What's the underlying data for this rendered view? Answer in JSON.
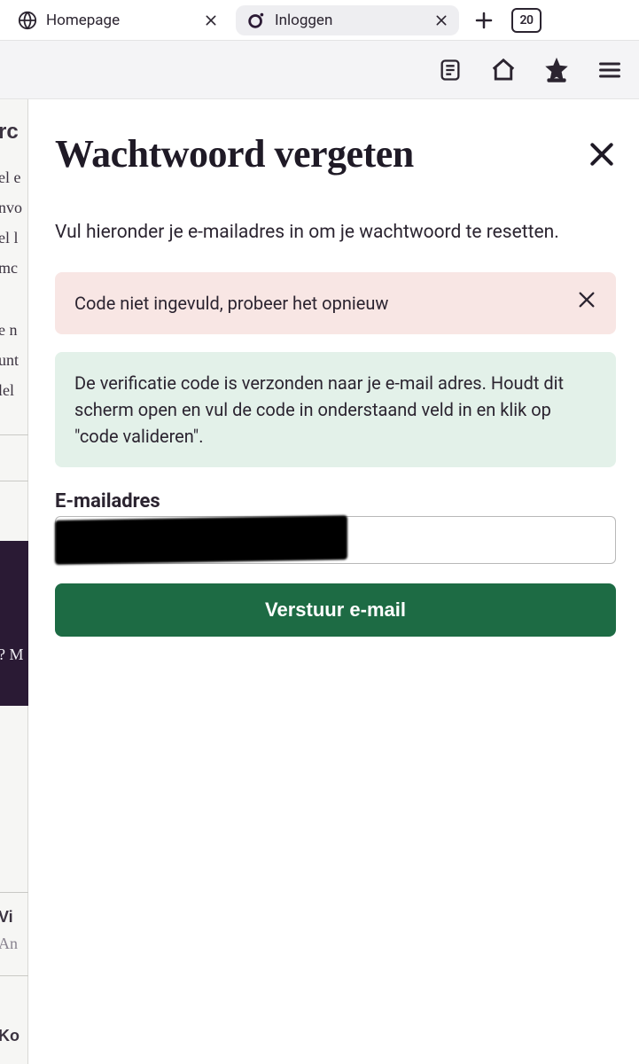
{
  "browser": {
    "tabs": [
      {
        "label": "Homepage"
      },
      {
        "label": "Inloggen"
      }
    ],
    "tab_count": "20"
  },
  "background": {
    "header0": "rc",
    "frags": [
      "el e",
      "nvo",
      "el l",
      "mc"
    ],
    "frags2": [
      "e n",
      "unt",
      "lel"
    ],
    "dark_frag": "? M",
    "vi": "Vi",
    "an": "An",
    "ko": "Ko"
  },
  "modal": {
    "title": "Wachtwoord vergeten",
    "instruction": "Vul hieronder je e-mailadres in om je wachtwoord te resetten.",
    "error_text": "Code niet ingevuld, probeer het opnieuw",
    "success_text": "De verificatie code is verzonden naar je e-mail adres. Houdt dit scherm open en vul de code in onderstaand veld in en klik op \"code valideren\".",
    "email_label": "E-mailadres",
    "email_value": "",
    "submit_label": "Verstuur e-mail"
  }
}
